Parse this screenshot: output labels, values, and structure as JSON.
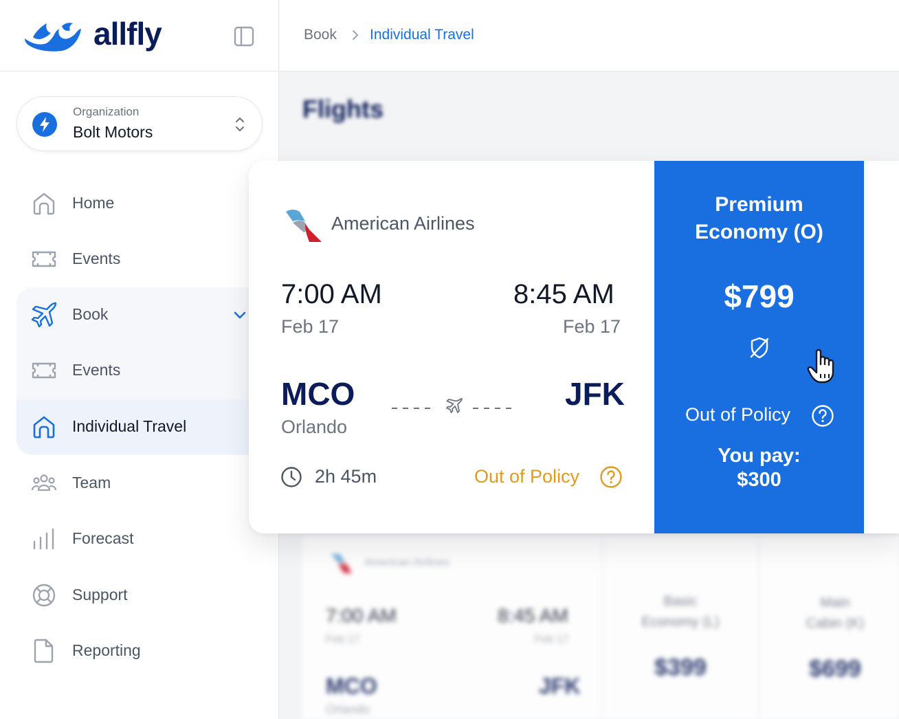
{
  "app": {
    "name": "allfly"
  },
  "organization": {
    "caption": "Organization",
    "name": "Bolt Motors"
  },
  "nav": {
    "home": "Home",
    "events": "Events",
    "book": "Book",
    "book_events": "Events",
    "individual_travel": "Individual Travel",
    "team": "Team",
    "forecast": "Forecast",
    "support": "Support",
    "reporting": "Reporting"
  },
  "breadcrumb": {
    "parent": "Book",
    "current": "Individual Travel"
  },
  "page": {
    "title": "Flights"
  },
  "featured_flight": {
    "airline": "American Airlines",
    "departure_time": "7:00 AM",
    "departure_date": "Feb 17",
    "arrival_time": "8:45 AM",
    "arrival_date": "Feb 17",
    "origin_code": "MCO",
    "origin_city": "Orlando",
    "destination_code": "JFK",
    "duration": "2h 45m",
    "policy_status": "Out of Policy",
    "fare": {
      "name_line1": "Premium",
      "name_line2": "Economy (O)",
      "price": "$799",
      "policy_status": "Out of Policy",
      "you_pay_label": "You pay:",
      "you_pay_amount": "$300"
    }
  },
  "background_flight": {
    "airline": "American Airlines",
    "departure_time": "7:00 AM",
    "departure_date": "Feb 17",
    "arrival_time": "8:45 AM",
    "arrival_date": "Feb 17",
    "origin_code": "MCO",
    "origin_city": "Orlando",
    "destination_code": "JFK",
    "fare1_line1": "Basic",
    "fare1_line2": "Economy (L)",
    "fare1_price": "$399",
    "fare2_line1": "Main",
    "fare2_line2": "Cabin (K)",
    "fare2_price": "$699"
  },
  "colors": {
    "brand_blue": "#1a6fe0",
    "navy": "#0b1c5a",
    "warning_orange": "#e29a1d",
    "sidebar_active": "#eef3fb"
  }
}
